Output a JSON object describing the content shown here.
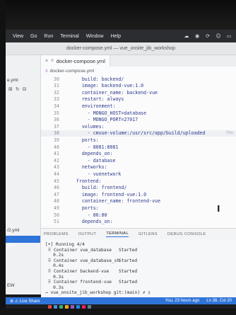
{
  "menubar": {
    "items": [
      "View",
      "Go",
      "Run",
      "Terminal",
      "Window",
      "Help"
    ]
  },
  "window": {
    "title": "docker-compose.yml — vue_onsite_jib_workshop"
  },
  "sidebar": {
    "file_label": "e.yml",
    "item_2": "/2.yml",
    "selected_label": "yml",
    "item_bottom": "EW"
  },
  "tabs": [
    {
      "label": "docker-compose.yml",
      "icon": "yml-icon"
    }
  ],
  "breadcrumb": {
    "label": "docker-compose.yml"
  },
  "editor": {
    "lines": [
      {
        "num": "30",
        "text": "      build: backend/"
      },
      {
        "num": "31",
        "text": "      image: backend-vue:1.0"
      },
      {
        "num": "32",
        "text": "      container_name: backend-vue"
      },
      {
        "num": "33",
        "text": "      restart: always"
      },
      {
        "num": "34",
        "text": "      environment:"
      },
      {
        "num": "35",
        "text": "        - MONGO_HOST=database"
      },
      {
        "num": "36",
        "text": "        - MONGO_PORT=27017"
      },
      {
        "num": "37",
        "text": "      volumes:"
      },
      {
        "num": "38",
        "text": "        - cmvue-volume:/usr/src/app/build/uploaded"
      },
      {
        "num": "39",
        "text": "      ports:"
      },
      {
        "num": "40",
        "text": "        - 8081:8081"
      },
      {
        "num": "41",
        "text": "      depends_on:"
      },
      {
        "num": "42",
        "text": "        - database"
      },
      {
        "num": "43",
        "text": "      networks:"
      },
      {
        "num": "44",
        "text": "        - vuenetwork"
      },
      {
        "num": "45",
        "text": "    frontend:"
      },
      {
        "num": "46",
        "text": "      build: frontend/"
      },
      {
        "num": "47",
        "text": "      image: frontend-vue:1.0"
      },
      {
        "num": "48",
        "text": "      container_name: frontend-vue"
      },
      {
        "num": "49",
        "text": "      ports:"
      },
      {
        "num": "50",
        "text": "        - 80:80"
      },
      {
        "num": "51",
        "text": "      depends_on:"
      }
    ],
    "hint": "You"
  },
  "panel": {
    "tabs": [
      "PROBLEMS",
      "OUTPUT",
      "TERMINAL",
      "GITLENS",
      "DEBUG CONSOLE"
    ],
    "active_tab": "TERMINAL"
  },
  "terminal": {
    "lines": [
      {
        "text": "[+] Running 4/4",
        "status": ""
      },
      {
        "text": " ⠿ Container vue_database",
        "status": "Started"
      },
      {
        "text": "   0.2s",
        "status": ""
      },
      {
        "text": " ⠿ Container vue_database_sh",
        "status": "Started"
      },
      {
        "text": "   0.4s",
        "status": ""
      },
      {
        "text": " ⠿ Container backend-vue",
        "status": "Started"
      },
      {
        "text": "   0.3s",
        "status": ""
      },
      {
        "text": " ⠿ Container frontend-vue",
        "status": "Started"
      },
      {
        "text": "   0.3s",
        "status": ""
      }
    ],
    "prompt": "→ vue_onsite_jib_workshop git:(main) ✗ ▯"
  },
  "statusbar": {
    "left": "⊗ ⚠ Live Share",
    "time": "You, 23 hours ago",
    "position": "Ln 38, Col 20"
  },
  "colors": {
    "accent": "#2f74d9",
    "menubar": "#2b2d31",
    "editor_bg": "#fbfbfc",
    "yaml_key": "#1f3a93"
  }
}
